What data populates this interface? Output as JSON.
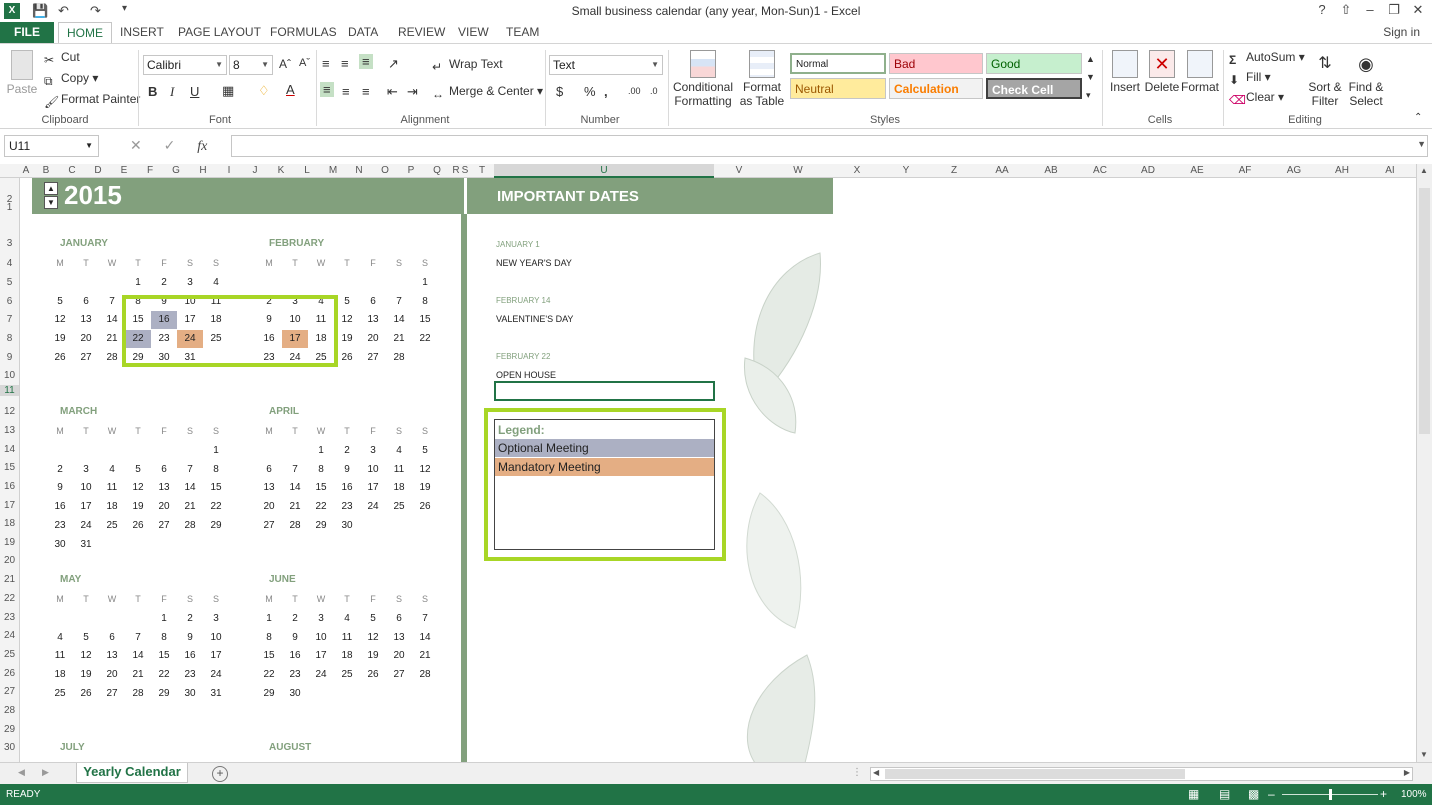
{
  "window": {
    "title": "Small business calendar (any year, Mon-Sun)1 - Excel",
    "help": "?",
    "controls": [
      "❐",
      "–",
      "❐",
      "✕"
    ]
  },
  "tabs": [
    "FILE",
    "HOME",
    "INSERT",
    "PAGE LAYOUT",
    "FORMULAS",
    "DATA",
    "REVIEW",
    "VIEW",
    "TEAM"
  ],
  "signin": "Sign in",
  "ribbon": {
    "clipboard": {
      "paste": "Paste",
      "cut": "Cut",
      "copy": "Copy",
      "format_painter": "Format Painter",
      "label": "Clipboard"
    },
    "font": {
      "name": "Calibri",
      "size": "8",
      "label": "Font",
      "bold": "B",
      "italic": "I",
      "underline": "U"
    },
    "alignment": {
      "wrap": "Wrap Text",
      "merge": "Merge & Center",
      "label": "Alignment"
    },
    "number": {
      "format": "Text",
      "currency": "$",
      "percent": "%",
      "comma": ",",
      "label": "Number"
    },
    "styles": {
      "conditional": "Conditional Formatting",
      "format_table": "Format as Table",
      "normal": "Normal",
      "bad": "Bad",
      "good": "Good",
      "neutral": "Neutral",
      "calculation": "Calculation",
      "check": "Check Cell",
      "label": "Styles"
    },
    "cells": {
      "insert": "Insert",
      "delete": "Delete",
      "format": "Format",
      "label": "Cells"
    },
    "editing": {
      "autosum": "AutoSum",
      "fill": "Fill",
      "clear": "Clear",
      "sort": "Sort & Filter",
      "find": "Find & Select",
      "label": "Editing"
    }
  },
  "formula_bar": {
    "namebox": "U11",
    "fx": "fx",
    "value": ""
  },
  "columns": [
    "A",
    "B",
    "C",
    "D",
    "E",
    "F",
    "G",
    "H",
    "I",
    "J",
    "K",
    "L",
    "M",
    "N",
    "O",
    "P",
    "Q",
    "R",
    "S",
    "T",
    "U",
    "V",
    "W",
    "X",
    "Y",
    "Z",
    "AA",
    "AB",
    "AC",
    "AD",
    "AE",
    "AF",
    "AG",
    "AH",
    "AI"
  ],
  "rows": [
    "1",
    "2",
    "3",
    "4",
    "5",
    "6",
    "7",
    "8",
    "9",
    "10",
    "11",
    "12",
    "13",
    "14",
    "15",
    "16",
    "17",
    "18",
    "19",
    "20",
    "21",
    "22",
    "23",
    "24",
    "25",
    "26",
    "27",
    "28",
    "29",
    "30"
  ],
  "calendar": {
    "year": "2015",
    "dow": [
      "M",
      "T",
      "W",
      "T",
      "F",
      "S",
      "S"
    ],
    "months": [
      {
        "name": "JANUARY",
        "weeks": [
          [
            "",
            "",
            "",
            "1",
            "2",
            "3",
            "4"
          ],
          [
            "5",
            "6",
            "7",
            "8",
            "9",
            "10",
            "11"
          ],
          [
            "12",
            "13",
            "14",
            "15",
            "16",
            "17",
            "18"
          ],
          [
            "19",
            "20",
            "21",
            "22",
            "23",
            "24",
            "25"
          ],
          [
            "26",
            "27",
            "28",
            "29",
            "30",
            "31",
            ""
          ]
        ]
      },
      {
        "name": "FEBRUARY",
        "weeks": [
          [
            "",
            "",
            "",
            "",
            "",
            "",
            "1"
          ],
          [
            "2",
            "3",
            "4",
            "5",
            "6",
            "7",
            "8"
          ],
          [
            "9",
            "10",
            "11",
            "12",
            "13",
            "14",
            "15"
          ],
          [
            "16",
            "17",
            "18",
            "19",
            "20",
            "21",
            "22"
          ],
          [
            "23",
            "24",
            "25",
            "26",
            "27",
            "28",
            ""
          ]
        ]
      },
      {
        "name": "MARCH",
        "weeks": [
          [
            "",
            "",
            "",
            "",
            "",
            "",
            "1"
          ],
          [
            "2",
            "3",
            "4",
            "5",
            "6",
            "7",
            "8"
          ],
          [
            "9",
            "10",
            "11",
            "12",
            "13",
            "14",
            "15"
          ],
          [
            "16",
            "17",
            "18",
            "19",
            "20",
            "21",
            "22"
          ],
          [
            "23",
            "24",
            "25",
            "26",
            "27",
            "28",
            "29"
          ],
          [
            "30",
            "31",
            "",
            "",
            "",
            "",
            ""
          ]
        ]
      },
      {
        "name": "APRIL",
        "weeks": [
          [
            "",
            "",
            "1",
            "2",
            "3",
            "4",
            "5"
          ],
          [
            "6",
            "7",
            "8",
            "9",
            "10",
            "11",
            "12"
          ],
          [
            "13",
            "14",
            "15",
            "16",
            "17",
            "18",
            "19"
          ],
          [
            "20",
            "21",
            "22",
            "23",
            "24",
            "25",
            "26"
          ],
          [
            "27",
            "28",
            "29",
            "30",
            "",
            "",
            ""
          ]
        ]
      },
      {
        "name": "MAY",
        "weeks": [
          [
            "",
            "",
            "",
            "",
            "1",
            "2",
            "3"
          ],
          [
            "4",
            "5",
            "6",
            "7",
            "8",
            "9",
            "10"
          ],
          [
            "11",
            "12",
            "13",
            "14",
            "15",
            "16",
            "17"
          ],
          [
            "18",
            "19",
            "20",
            "21",
            "22",
            "23",
            "24"
          ],
          [
            "25",
            "26",
            "27",
            "28",
            "29",
            "30",
            "31"
          ]
        ]
      },
      {
        "name": "JUNE",
        "weeks": [
          [
            "1",
            "2",
            "3",
            "4",
            "5",
            "6",
            "7"
          ],
          [
            "8",
            "9",
            "10",
            "11",
            "12",
            "13",
            "14"
          ],
          [
            "15",
            "16",
            "17",
            "18",
            "19",
            "20",
            "21"
          ],
          [
            "22",
            "23",
            "24",
            "25",
            "26",
            "27",
            "28"
          ],
          [
            "29",
            "30",
            "",
            "",
            "",
            "",
            ""
          ]
        ]
      },
      {
        "name": "JULY",
        "weeks": []
      },
      {
        "name": "AUGUST",
        "weeks": []
      }
    ],
    "optional_days": [
      {
        "month": 0,
        "day": "16"
      },
      {
        "month": 0,
        "day": "22"
      }
    ],
    "mandatory_days": [
      {
        "month": 0,
        "day": "24"
      },
      {
        "month": 1,
        "day": "17"
      }
    ]
  },
  "important": {
    "title": "IMPORTANT DATES",
    "events": [
      {
        "date": "JANUARY 1",
        "name": "NEW YEAR'S DAY"
      },
      {
        "date": "FEBRUARY 14",
        "name": "VALENTINE'S DAY"
      },
      {
        "date": "FEBRUARY 22",
        "name": "OPEN HOUSE"
      }
    ]
  },
  "legend": {
    "title": "Legend:",
    "items": [
      {
        "label": "Optional Meeting",
        "color": "#acb0c3"
      },
      {
        "label": "Mandatory Meeting",
        "color": "#e4ae84"
      }
    ]
  },
  "sheet_tab": "Yearly Calendar",
  "status": {
    "text": "READY",
    "zoom": "100%"
  },
  "colors": {
    "accent": "#217346",
    "header_green": "#82a07d",
    "highlight": "#a8d626"
  }
}
